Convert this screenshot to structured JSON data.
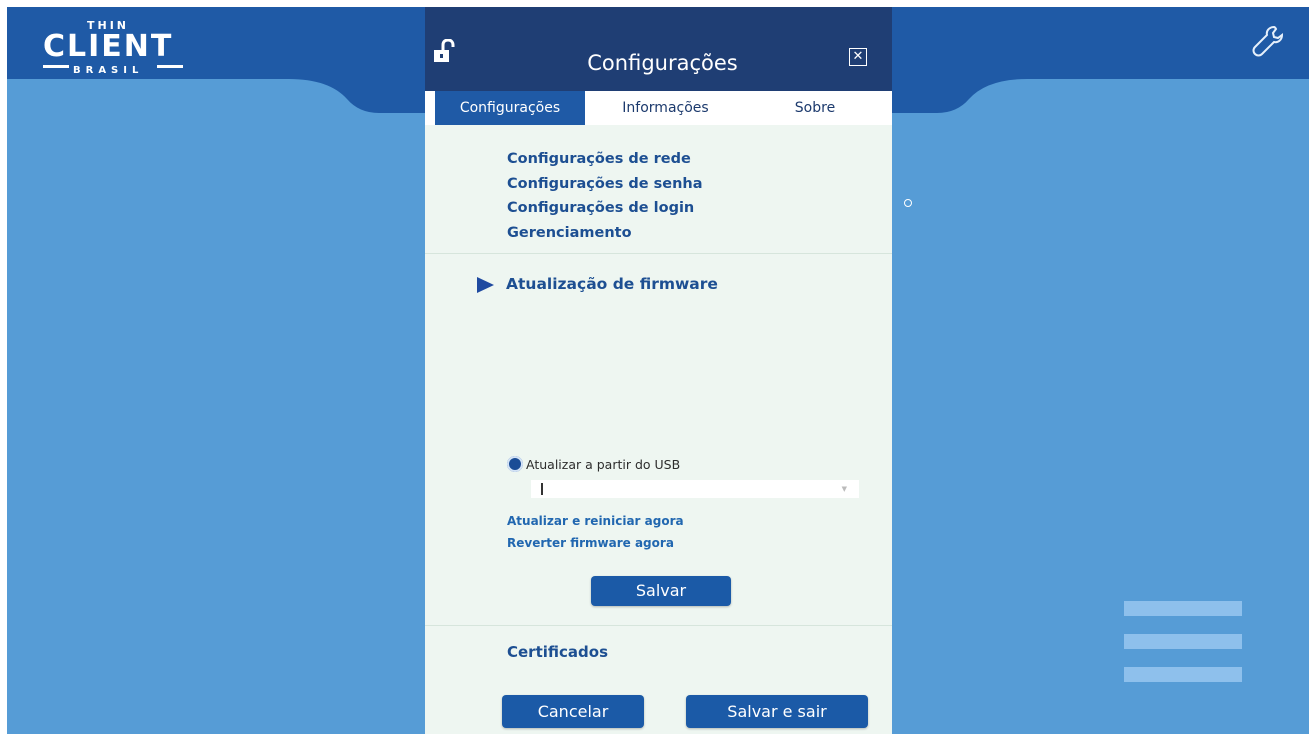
{
  "logo": {
    "line1": "THIN",
    "line2": "CLIENT",
    "line3": "BRASIL"
  },
  "dialog": {
    "title": "Configurações",
    "lock_icon": "unlock-icon",
    "close_icon": "close-box-icon"
  },
  "tabs": [
    {
      "label": "Configurações",
      "active": true
    },
    {
      "label": "Informações",
      "active": false
    },
    {
      "label": "Sobre",
      "active": false
    }
  ],
  "menu": {
    "items": [
      "Configurações de rede",
      "Configurações de senha",
      "Configurações de login",
      "Gerenciamento"
    ],
    "firmware_label": "Atualização de firmware"
  },
  "firmware": {
    "usb_option_label": "Atualizar a partir do USB",
    "usb_selected": true,
    "select_value": "",
    "update_restart_link": "Atualizar e reiniciar agora",
    "revert_link": "Reverter firmware agora",
    "save_button": "Salvar"
  },
  "certificates_label": "Certificados",
  "footer": {
    "cancel_button": "Cancelar",
    "save_exit_button": "Salvar e sair"
  },
  "colors": {
    "background": "#569cd6",
    "header": "#1f5aa6",
    "dialog_header": "#1f3e74",
    "dialog_body": "#eef6f1",
    "accent": "#1b5aa7"
  },
  "icons": {
    "settings": "wrench-icon",
    "menu": "hamburger-menu-icon"
  }
}
